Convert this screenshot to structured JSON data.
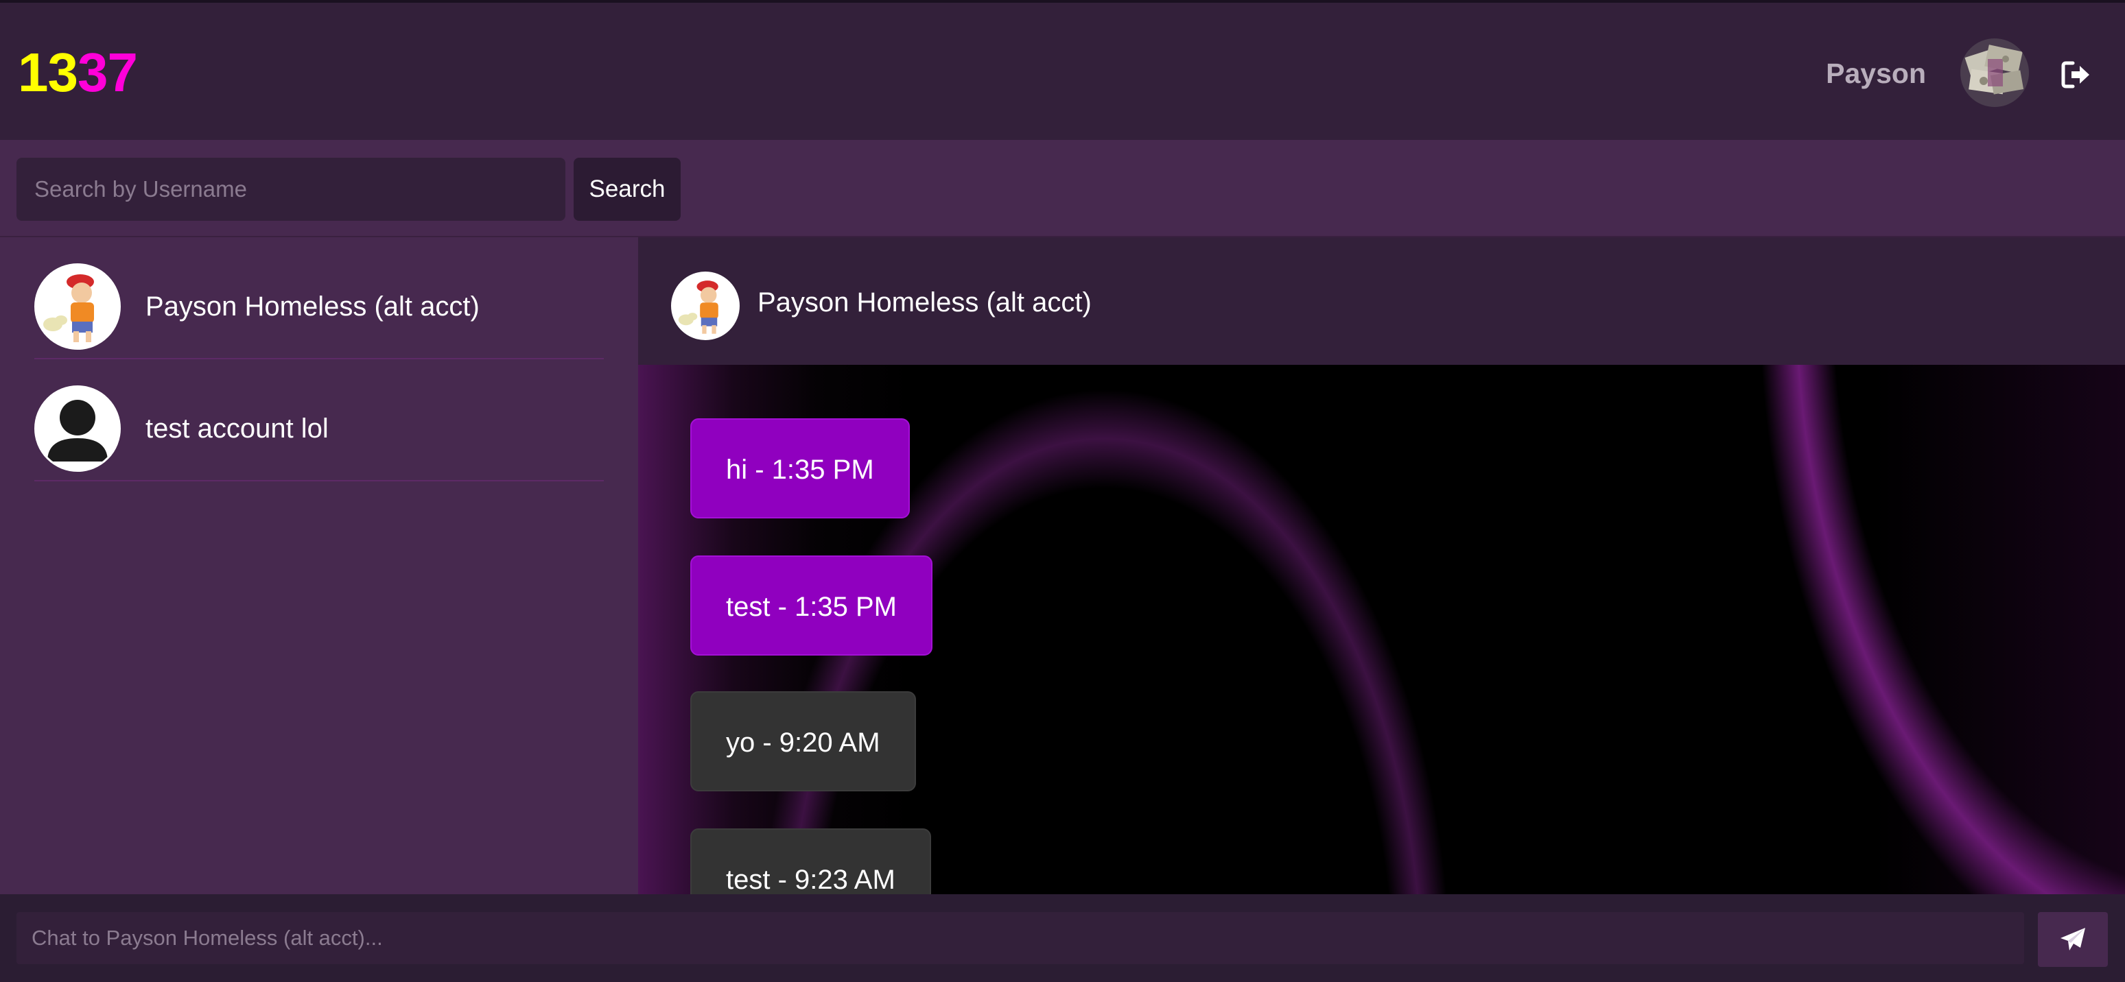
{
  "header": {
    "logo_part1": "13",
    "logo_part2": "37",
    "username": "Payson",
    "logo_colors": {
      "part1": "#ffff00",
      "part2": "#ff00d9"
    },
    "logout_icon": "sign-out-icon"
  },
  "search": {
    "placeholder": "Search by Username",
    "value": "",
    "button_label": "Search"
  },
  "contacts": [
    {
      "name": "Payson Homeless (alt acct)",
      "avatar": "cartoon-avatar"
    },
    {
      "name": "test account lol",
      "avatar": "default-user-avatar"
    }
  ],
  "chat": {
    "active_name": "Payson Homeless (alt acct)",
    "messages": [
      {
        "text": "hi - 1:35 PM",
        "type": "sent"
      },
      {
        "text": "test - 1:35 PM",
        "type": "sent"
      },
      {
        "text": "yo - 9:20 AM",
        "type": "received"
      },
      {
        "text": "test - 9:23 AM",
        "type": "received"
      }
    ],
    "input_placeholder": "Chat to Payson Homeless (alt acct)...",
    "input_value": "",
    "send_icon": "paper-plane-icon"
  },
  "colors": {
    "header_bg": "#33203a",
    "panel_bg": "#47294f",
    "sent_bubble": "#9000bf",
    "received_bubble": "#333333"
  }
}
